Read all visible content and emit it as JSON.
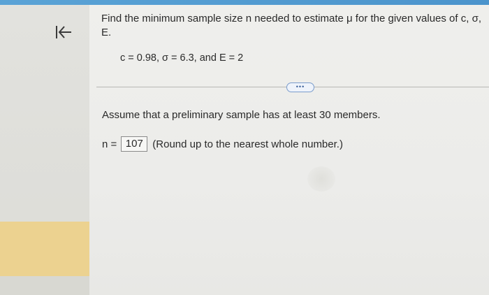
{
  "colors": {
    "top_bar": "#4f98ce",
    "sidebar_highlight": "#ecd290",
    "text": "#2a2a2a"
  },
  "sidebar": {
    "back_icon": "arrow-left-to-bar-icon"
  },
  "question": {
    "prompt": "Find the minimum sample size n needed to estimate μ for the given values of c, σ, E.",
    "given_values": "c = 0.98, σ = 6.3, and E = 2"
  },
  "more_button": {
    "label": "•••"
  },
  "solution": {
    "assumption": "Assume that a preliminary sample has at least 30 members.",
    "answer_label": "n =",
    "answer_value": "107",
    "answer_hint": "(Round up to the nearest whole number.)"
  }
}
